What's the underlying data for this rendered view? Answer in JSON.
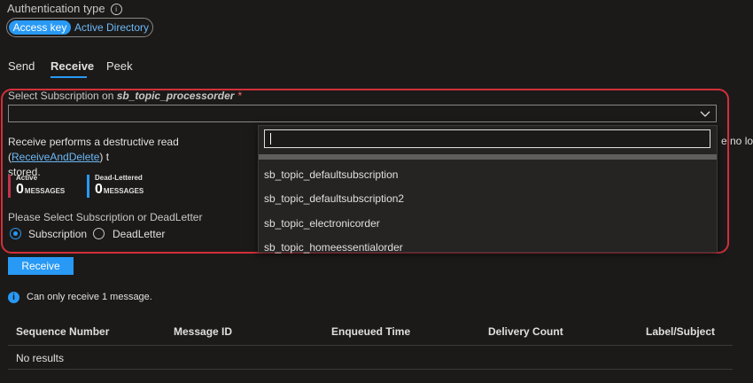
{
  "auth": {
    "label": "Authentication type",
    "options": [
      "Access key",
      "Active Directory"
    ],
    "selected": "Access key"
  },
  "tabs": [
    {
      "label": "Send",
      "active": false
    },
    {
      "label": "Receive",
      "active": true
    },
    {
      "label": "Peek",
      "active": false
    }
  ],
  "subscription": {
    "label_prefix": "Select Subscription on",
    "topic": "sb_topic_processorder",
    "required_mark": "*",
    "value": ""
  },
  "description": {
    "before_link": "Receive performs a destructive read (",
    "link": "ReceiveAndDelete",
    "after_link": ") t",
    "line2": "stored.",
    "tail": "e no long"
  },
  "metrics": [
    {
      "title": "Active",
      "value": "0",
      "unit": "MESSAGES",
      "color": "#c4314b"
    },
    {
      "title": "Dead-Lettered",
      "value": "0",
      "unit": "MESSAGES",
      "color": "#2899f5"
    }
  ],
  "source": {
    "label": "Please Select Subscription or DeadLetter",
    "options": [
      "Subscription",
      "DeadLetter"
    ],
    "selected": "Subscription"
  },
  "dropdown": {
    "search_value": "",
    "items": [
      "sb_topic_defaultsubscription",
      "sb_topic_defaultsubscription2",
      "sb_topic_electronicorder",
      "sb_topic_homeessentialorder"
    ]
  },
  "receive_button": "Receive",
  "note": "Can only receive 1 message.",
  "table": {
    "columns": [
      "Sequence Number",
      "Message ID",
      "Enqueued Time",
      "Delivery Count",
      "Label/Subject"
    ],
    "empty_text": "No results"
  },
  "colors": {
    "accent": "#2899f5",
    "highlight_border": "#d32f3a",
    "background": "#1b1a19"
  }
}
